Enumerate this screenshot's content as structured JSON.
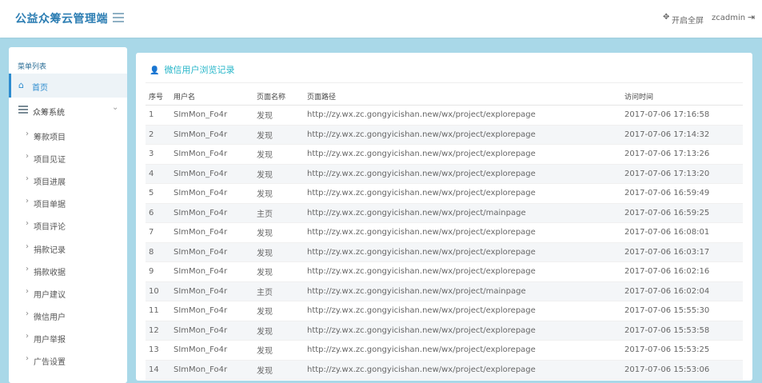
{
  "header": {
    "brand": "公益众筹云管理端",
    "fullscreen_icon": "✥",
    "fullscreen_label": "开启全屏",
    "username": "zcadmin",
    "logout_icon": "⇥"
  },
  "sidebar": {
    "title": "菜单列表",
    "home": {
      "icon": "home-icon",
      "label": "首页"
    },
    "group": {
      "icon": "list-icon",
      "label": "众筹系统",
      "chevron": "⌄"
    },
    "items": [
      {
        "label": "筹款项目"
      },
      {
        "label": "项目见证"
      },
      {
        "label": "项目进展"
      },
      {
        "label": "项目单据"
      },
      {
        "label": "项目评论"
      },
      {
        "label": "捐款记录"
      },
      {
        "label": "捐款收据"
      },
      {
        "label": "用户建议"
      },
      {
        "label": "微信用户"
      },
      {
        "label": "用户举报"
      },
      {
        "label": "广告设置"
      }
    ]
  },
  "panel": {
    "icon": "user-icon",
    "title": "微信用户浏览记录",
    "columns": [
      "序号",
      "用户名",
      "页面名称",
      "页面路径",
      "访问时间"
    ],
    "rows": [
      {
        "no": "1",
        "user": "SImMon_Fo4r",
        "page": "发现",
        "path": "http://zy.wx.zc.gongyicishan.new/wx/project/explorepage",
        "time": "2017-07-06 17:16:58"
      },
      {
        "no": "2",
        "user": "SImMon_Fo4r",
        "page": "发现",
        "path": "http://zy.wx.zc.gongyicishan.new/wx/project/explorepage",
        "time": "2017-07-06 17:14:32"
      },
      {
        "no": "3",
        "user": "SImMon_Fo4r",
        "page": "发现",
        "path": "http://zy.wx.zc.gongyicishan.new/wx/project/explorepage",
        "time": "2017-07-06 17:13:26"
      },
      {
        "no": "4",
        "user": "SImMon_Fo4r",
        "page": "发现",
        "path": "http://zy.wx.zc.gongyicishan.new/wx/project/explorepage",
        "time": "2017-07-06 17:13:20"
      },
      {
        "no": "5",
        "user": "SImMon_Fo4r",
        "page": "发现",
        "path": "http://zy.wx.zc.gongyicishan.new/wx/project/explorepage",
        "time": "2017-07-06 16:59:49"
      },
      {
        "no": "6",
        "user": "SImMon_Fo4r",
        "page": "主页",
        "path": "http://zy.wx.zc.gongyicishan.new/wx/project/mainpage",
        "time": "2017-07-06 16:59:25"
      },
      {
        "no": "7",
        "user": "SImMon_Fo4r",
        "page": "发现",
        "path": "http://zy.wx.zc.gongyicishan.new/wx/project/explorepage",
        "time": "2017-07-06 16:08:01"
      },
      {
        "no": "8",
        "user": "SImMon_Fo4r",
        "page": "发现",
        "path": "http://zy.wx.zc.gongyicishan.new/wx/project/explorepage",
        "time": "2017-07-06 16:03:17"
      },
      {
        "no": "9",
        "user": "SImMon_Fo4r",
        "page": "发现",
        "path": "http://zy.wx.zc.gongyicishan.new/wx/project/explorepage",
        "time": "2017-07-06 16:02:16"
      },
      {
        "no": "10",
        "user": "SImMon_Fo4r",
        "page": "主页",
        "path": "http://zy.wx.zc.gongyicishan.new/wx/project/mainpage",
        "time": "2017-07-06 16:02:04"
      },
      {
        "no": "11",
        "user": "SImMon_Fo4r",
        "page": "发现",
        "path": "http://zy.wx.zc.gongyicishan.new/wx/project/explorepage",
        "time": "2017-07-06 15:55:30"
      },
      {
        "no": "12",
        "user": "SImMon_Fo4r",
        "page": "发现",
        "path": "http://zy.wx.zc.gongyicishan.new/wx/project/explorepage",
        "time": "2017-07-06 15:53:58"
      },
      {
        "no": "13",
        "user": "SImMon_Fo4r",
        "page": "发现",
        "path": "http://zy.wx.zc.gongyicishan.new/wx/project/explorepage",
        "time": "2017-07-06 15:53:25"
      },
      {
        "no": "14",
        "user": "SImMon_Fo4r",
        "page": "发现",
        "path": "http://zy.wx.zc.gongyicishan.new/wx/project/explorepage",
        "time": "2017-07-06 15:53:06"
      }
    ]
  }
}
